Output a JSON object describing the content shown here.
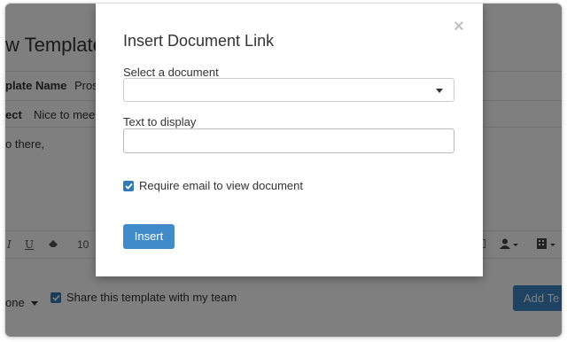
{
  "background_page": {
    "title": "w Template",
    "template_name_label": "plate Name",
    "template_name_value": "Pros",
    "subject_label": "ect",
    "subject_value": "Nice to meet",
    "body_text": "o there,",
    "toolbar": {
      "italic": "I",
      "underline": "U",
      "font_size": "10"
    },
    "footer_left": "one",
    "share_label": "Share this template with my team",
    "share_checked": true,
    "add_button": "Add Te"
  },
  "modal": {
    "title": "Insert Document Link",
    "close_symbol": "×",
    "select_label": "Select a document",
    "select_value": "",
    "text_label": "Text to display",
    "text_value": "",
    "require_email_label": "Require email to view document",
    "require_email_checked": true,
    "insert_button": "Insert"
  },
  "colors": {
    "primary": "#428bca",
    "overlay": "rgba(0,0,0,0.5)"
  }
}
